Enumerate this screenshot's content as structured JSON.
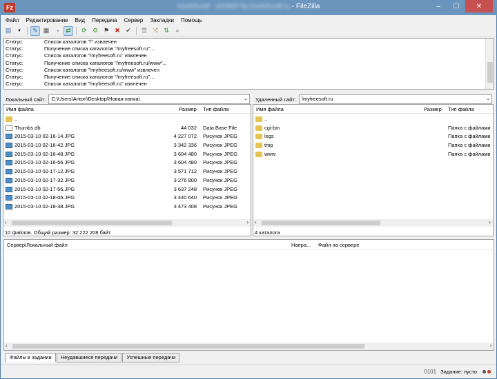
{
  "window": {
    "title_blurred": "madeforall - sh0960 ftp.madeforall.ru",
    "title_suffix": " - FileZilla",
    "app_icon": "Fz",
    "minimize": "–",
    "maximize": "☐",
    "close": "✕"
  },
  "menu": [
    "Файл",
    "Редактирование",
    "Вид",
    "Передача",
    "Сервер",
    "Закладки",
    "Помощь"
  ],
  "toolbar_icons": [
    "site-manager-icon",
    "dropdown-arrow-icon",
    "toggle-log-icon",
    "toggle-local-tree-icon",
    "toggle-remote-tree-icon",
    "toggle-queue-icon",
    "refresh-icon",
    "process-queue-icon",
    "cancel-icon",
    "disconnect-icon",
    "reconnect-icon",
    "filter-icon",
    "compare-icon",
    "sync-browse-icon",
    "search-icon"
  ],
  "log": [
    {
      "status": "Статус:",
      "text": "Список каталогов \"/\" извлечен"
    },
    {
      "status": "Статус:",
      "text": "Получение списка каталогов \"/myfreesoft.ru\"..."
    },
    {
      "status": "Статус:",
      "text": "Список каталогов \"/myfreesoft.ru\" извлечен"
    },
    {
      "status": "Статус:",
      "text": "Получение списка каталогов \"/myfreesoft.ru/www\"..."
    },
    {
      "status": "Статус:",
      "text": "Список каталогов \"/myfreesoft.ru/www\" извлечен"
    },
    {
      "status": "Статус:",
      "text": "Получение списка каталогов \"/myfreesoft.ru\"..."
    },
    {
      "status": "Статус:",
      "text": "Список каталогов \"/myfreesoft.ru\" извлечен"
    }
  ],
  "local": {
    "label": "Локальный сайт:",
    "path": "C:\\Users\\Anton\\Desktop\\Новая папка\\",
    "col_name": "Имя файла",
    "col_size": "Размер",
    "col_type": "Тип файла",
    "files": [
      {
        "name": "..",
        "size": "",
        "type": "",
        "icon": "folder"
      },
      {
        "name": "Thumbs.db",
        "size": "44 032",
        "type": "Data Base File",
        "icon": "db"
      },
      {
        "name": "2015-03-10 02-16-14.JPG",
        "size": "4 227 072",
        "type": "Рисунок JPEG",
        "icon": "img"
      },
      {
        "name": "2015-03-10 02-16-42.JPG",
        "size": "3 342 336",
        "type": "Рисунок JPEG",
        "icon": "img"
      },
      {
        "name": "2015-03-10 02-16-48.JPG",
        "size": "3 604 480",
        "type": "Рисунок JPEG",
        "icon": "img"
      },
      {
        "name": "2015-03-10 02-16-56.JPG",
        "size": "3 604 480",
        "type": "Рисунок JPEG",
        "icon": "img"
      },
      {
        "name": "2015-03-10 02-17-12.JPG",
        "size": "3 571 712",
        "type": "Рисунок JPEG",
        "icon": "img"
      },
      {
        "name": "2015-03-10 02-17-32.JPG",
        "size": "3 276 800",
        "type": "Рисунок JPEG",
        "icon": "img"
      },
      {
        "name": "2015-03-10 02-17-56.JPG",
        "size": "3 637 248",
        "type": "Рисунок JPEG",
        "icon": "img"
      },
      {
        "name": "2015-03-10 02-18-06.JPG",
        "size": "3 440 640",
        "type": "Рисунок JPEG",
        "icon": "img"
      },
      {
        "name": "2015-03-10 02-18-38.JPG",
        "size": "3 473 408",
        "type": "Рисунок JPEG",
        "icon": "img"
      }
    ],
    "summary": "10 файлов. Общий размер: 32 222 208 байт"
  },
  "remote": {
    "label": "Удаленный сайт:",
    "path": "/myfreesoft.ru",
    "col_name": "Имя файла",
    "col_size": "Размер",
    "col_type": "Тип файла",
    "files": [
      {
        "name": "..",
        "type": ""
      },
      {
        "name": "cgi-bin",
        "type": "Папка с файлами"
      },
      {
        "name": "logs",
        "type": "Папка с файлами"
      },
      {
        "name": "tmp",
        "type": "Папка с файлами"
      },
      {
        "name": "www",
        "type": "Папка с файлами"
      }
    ],
    "summary": "4 каталога"
  },
  "queue": {
    "col_server": "Сервер/Локальный файл",
    "col_direction": "Напра...",
    "col_remote": "Файл на сервере"
  },
  "tabs": [
    "Файлы в задании",
    "Неудавшиеся передачи",
    "Успешные передачи"
  ],
  "statusbar": {
    "queue_text": "Задание: пусто",
    "icon_text": "0101"
  }
}
